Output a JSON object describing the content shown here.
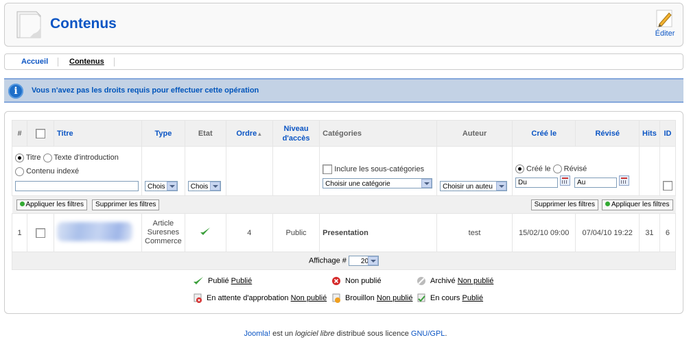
{
  "header": {
    "title": "Contenus",
    "edit_label": "Éditer"
  },
  "submenu": {
    "items": [
      {
        "label": "Accueil"
      },
      {
        "label": "Contenus"
      }
    ]
  },
  "notice": {
    "message": "Vous n'avez pas les droits requis pour effectuer cette opération"
  },
  "table": {
    "headers": {
      "num": "#",
      "titre": "Titre",
      "type": "Type",
      "etat": "Etat",
      "ordre": "Ordre",
      "niveau1": "Niveau",
      "niveau2": "d'accès",
      "categories": "Catégories",
      "auteur": "Auteur",
      "cree": "Créé le",
      "revise": "Révisé",
      "hits": "Hits",
      "id": "ID"
    },
    "filters": {
      "radio_titre": "Titre",
      "radio_intro": "Texte d'introduction",
      "radio_contenu": "Contenu indexé",
      "type_select": "Chois",
      "etat_select": "Chois",
      "include_sub": "Inclure les sous-catégories",
      "cat_select": "Choisir une catégorie",
      "author_select": "Choisir un auteu",
      "radio_cree": "Créé le",
      "radio_revise": "Révisé",
      "du": "Du",
      "au": "Au",
      "apply": "Appliquer les filtres",
      "remove": "Supprimer les filtres"
    },
    "rows": [
      {
        "num": "1",
        "type_lines": [
          "Article",
          "Suresnes",
          "Commerce"
        ],
        "ordre": "4",
        "niveau": "Public",
        "categorie": "Presentation",
        "auteur": "test",
        "cree": "15/02/10 09:00",
        "revise": "07/04/10 19:22",
        "hits": "31",
        "id": "6"
      }
    ],
    "pager": {
      "label": "Affichage #",
      "value": "20"
    }
  },
  "legend": {
    "publie": "Publié",
    "publie_link": "Publié",
    "non_publie": "Non publié",
    "archive": "Archivé",
    "archive_link": "Non publié",
    "attente": "En attente d'approbation",
    "attente_link": "Non publié",
    "brouillon": "Brouillon",
    "brouillon_link": "Non publié",
    "en_cours": "En cours",
    "en_cours_link": "Publié"
  },
  "footer": {
    "joomla": "Joomla!",
    "text1": " est un ",
    "libre": "logiciel libre",
    "text2": " distribué sous licence ",
    "gpl": "GNU/GPL",
    "text3": "."
  },
  "colors": {
    "accent": "#0b55c4",
    "notice_bg": "#c3d2e5",
    "notice_text": "#0055bb"
  }
}
